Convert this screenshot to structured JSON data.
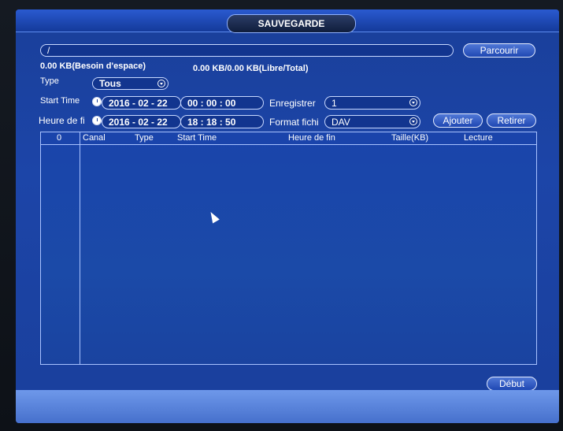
{
  "window": {
    "title": "SAUVEGARDE"
  },
  "path_field": {
    "value": "/"
  },
  "browse_button": {
    "label": "Parcourir"
  },
  "space_needed": "0.00 KB(Besoin d'espace)",
  "space_free_total": "0.00 KB/0.00 KB(Libre/Total)",
  "type": {
    "label": "Type",
    "value": "Tous"
  },
  "start_time": {
    "label": "Start Time",
    "date": "2016 - 02 - 22",
    "time": "00 : 00 : 00"
  },
  "end_time": {
    "label": "Heure de fi",
    "date": "2016 - 02 - 22",
    "time": "18 : 18 : 50"
  },
  "recorder": {
    "label": "Enregistrer",
    "value": "1"
  },
  "format": {
    "label": "Format fichi",
    "value": "DAV"
  },
  "add_button": {
    "label": "Ajouter"
  },
  "remove_button": {
    "label": "Retirer"
  },
  "table": {
    "columns": [
      "0",
      "Canal",
      "Type",
      "Start Time",
      "Heure de fin",
      "Taille(KB)",
      "Lecture"
    ],
    "rows": []
  },
  "start_button": {
    "label": "Début"
  }
}
